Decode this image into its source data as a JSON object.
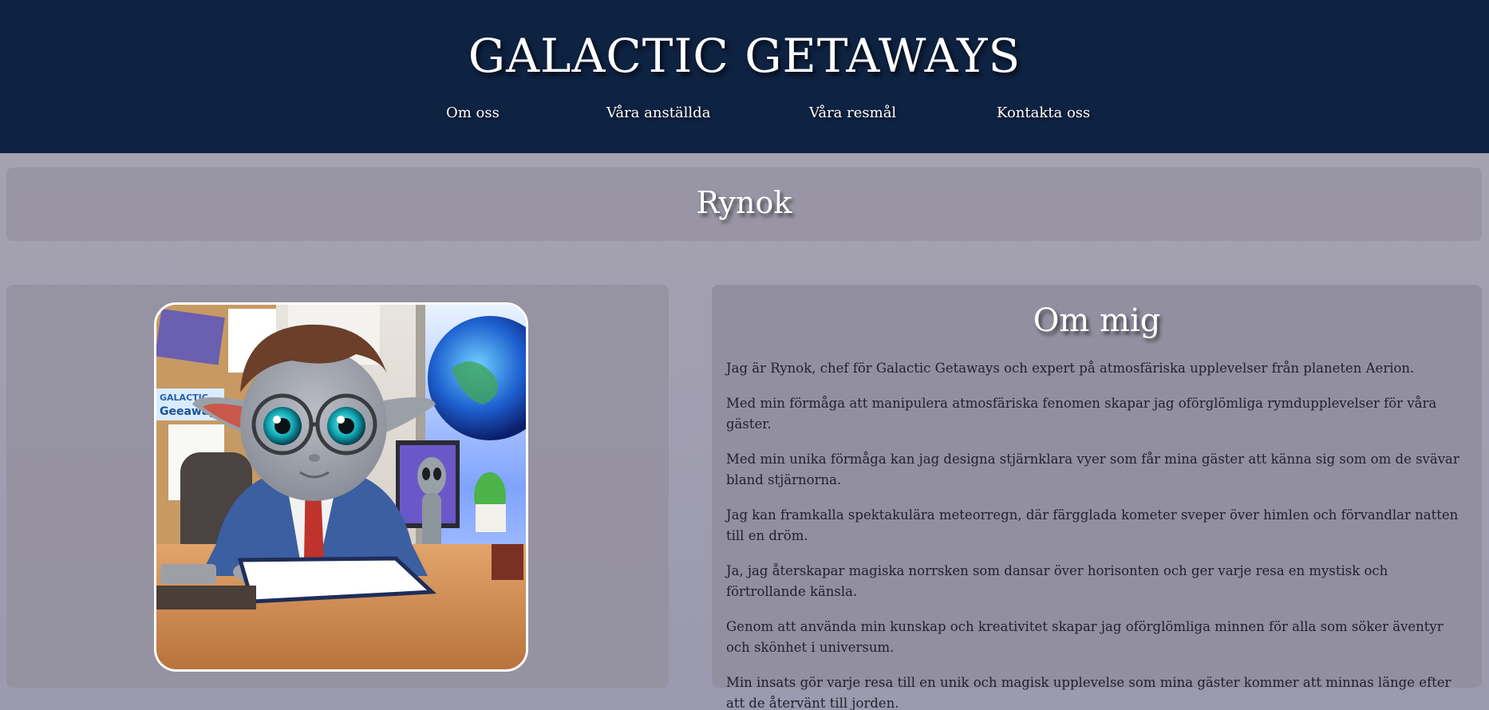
{
  "header": {
    "site_title": "GALACTIC GETAWAYS",
    "nav": [
      {
        "label": "Om oss"
      },
      {
        "label": "Våra anställda"
      },
      {
        "label": "Våra resmål"
      },
      {
        "label": "Kontakta oss"
      }
    ]
  },
  "profile": {
    "name": "Rynok"
  },
  "portrait": {
    "alt": "Rynok",
    "sign_line1": "GALACTIC",
    "sign_line2": "Geeaways"
  },
  "about": {
    "title": "Om mig",
    "paragraphs": [
      "Jag är Rynok, chef för Galactic Getaways och expert på atmosfäriska upplevelser från planeten Aerion.",
      "Med min förmåga att manipulera atmosfäriska fenomen skapar jag oförglömliga rymdupplevelser för våra gäster.",
      "Med min unika förmåga kan jag designa stjärnklara vyer som får mina gäster att känna sig som om de svävar bland stjärnorna.",
      "Jag kan framkalla spektakulära meteorregn, där färgglada kometer sveper över himlen och förvandlar natten till en dröm.",
      "Ja, jag återskapar magiska norrsken som dansar över horisonten och ger varje resa en mystisk och förtrollande känsla.",
      "Genom att använda min kunskap och kreativitet skapar jag oförglömliga minnen för alla som söker äventyr och skönhet i universum.",
      "Min insats gör varje resa till en unik och magisk upplevelse som mina gäster kommer att minnas länge efter att de återvänt till jorden."
    ]
  },
  "colors": {
    "header_bg": "#0e2242",
    "page_bg": "#a19fb0",
    "panel_bg": "#96929f",
    "heading_text": "#ffffff",
    "body_text": "#22212c"
  }
}
